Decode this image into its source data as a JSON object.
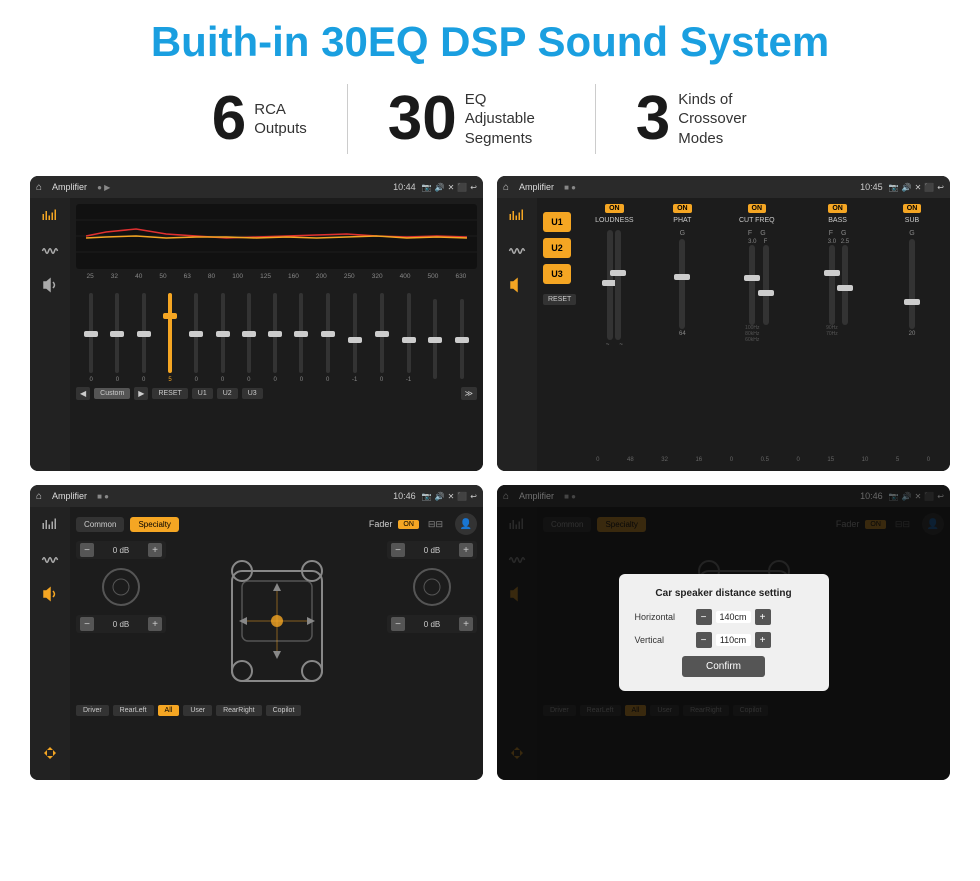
{
  "title": "Buith-in 30EQ DSP Sound System",
  "stats": [
    {
      "number": "6",
      "text_line1": "RCA",
      "text_line2": "Outputs"
    },
    {
      "number": "30",
      "text_line1": "EQ Adjustable",
      "text_line2": "Segments"
    },
    {
      "number": "3",
      "text_line1": "Kinds of",
      "text_line2": "Crossover Modes"
    }
  ],
  "screens": [
    {
      "id": "eq-screen",
      "title": "Amplifier",
      "time": "10:44",
      "type": "eq"
    },
    {
      "id": "crossover-screen",
      "title": "Amplifier",
      "time": "10:45",
      "type": "crossover"
    },
    {
      "id": "fader-screen",
      "title": "Amplifier",
      "time": "10:46",
      "type": "fader"
    },
    {
      "id": "dialog-screen",
      "title": "Amplifier",
      "time": "10:46",
      "type": "dialog"
    }
  ],
  "eq": {
    "freqs": [
      "25",
      "32",
      "40",
      "50",
      "63",
      "80",
      "100",
      "125",
      "160",
      "200",
      "250",
      "320",
      "400",
      "500",
      "630"
    ],
    "values": [
      "0",
      "0",
      "0",
      "5",
      "0",
      "0",
      "0",
      "0",
      "0",
      "0",
      "-1",
      "0",
      "-1",
      "",
      ""
    ],
    "preset": "Custom",
    "buttons": [
      "RESET",
      "U1",
      "U2",
      "U3"
    ]
  },
  "crossover": {
    "u_buttons": [
      "U1",
      "U2",
      "U3"
    ],
    "channels": [
      {
        "on": true,
        "name": "LOUDNESS"
      },
      {
        "on": true,
        "name": "PHAT"
      },
      {
        "on": true,
        "name": "CUT FREQ"
      },
      {
        "on": true,
        "name": "BASS"
      },
      {
        "on": true,
        "name": "SUB"
      }
    ],
    "reset": "RESET"
  },
  "fader": {
    "modes": [
      "Common",
      "Specialty"
    ],
    "active_mode": "Specialty",
    "fader_label": "Fader",
    "fader_on": "ON",
    "left_db": [
      "0 dB",
      "0 dB"
    ],
    "right_db": [
      "0 dB",
      "0 dB"
    ],
    "bottom_buttons": [
      "Driver",
      "RearLeft",
      "All",
      "User",
      "RearRight",
      "Copilot"
    ]
  },
  "dialog": {
    "title": "Car speaker distance setting",
    "rows": [
      {
        "label": "Horizontal",
        "value": "140cm"
      },
      {
        "label": "Vertical",
        "value": "110cm"
      }
    ],
    "confirm": "Confirm"
  }
}
